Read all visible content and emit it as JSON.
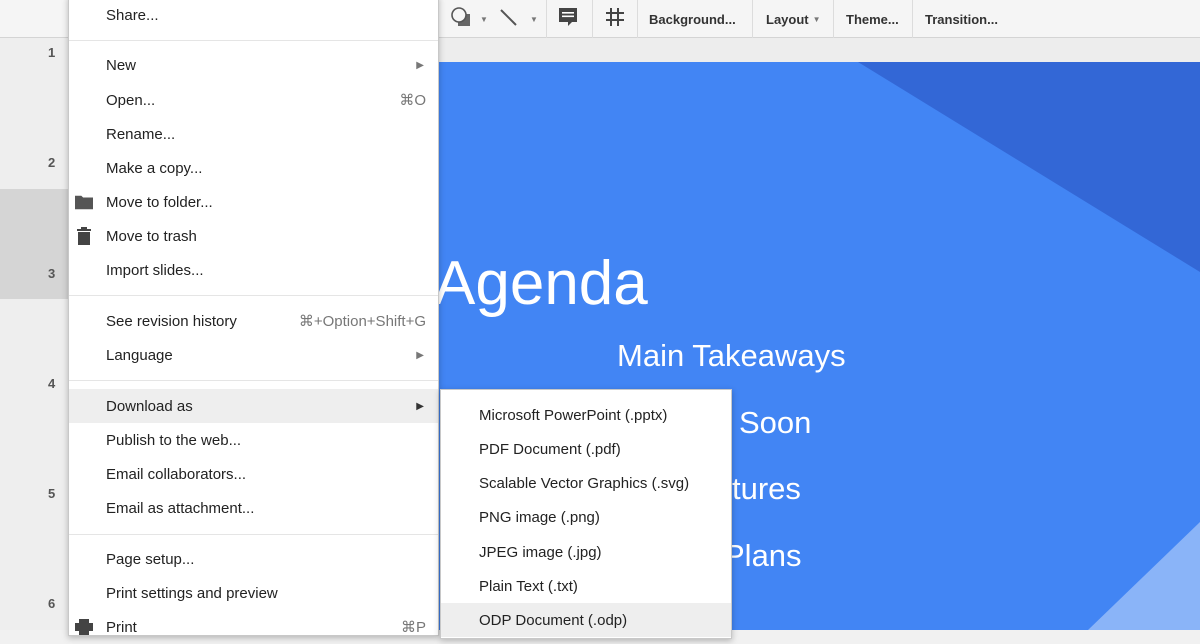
{
  "toolbar": {
    "icons": [
      "shape-icon",
      "line-icon",
      "comment-icon",
      "grid-icon"
    ],
    "buttons": {
      "background": "Background...",
      "layout": "Layout",
      "theme": "Theme...",
      "transition": "Transition..."
    }
  },
  "filmstrip": {
    "slide_numbers": [
      "1",
      "2",
      "3",
      "4",
      "5",
      "6"
    ],
    "selected": "2"
  },
  "slide": {
    "title": "Agenda",
    "lines": [
      "Main Takeaways",
      "Soon",
      "tures",
      "Plans"
    ],
    "colors": {
      "background": "#4285f4",
      "shape_dark": "#3367d6",
      "shape_light": "#8ab4f8"
    }
  },
  "file_menu": {
    "share": "Share...",
    "new": "New",
    "open": "Open...",
    "open_shortcut": "⌘O",
    "rename": "Rename...",
    "make_copy": "Make a copy...",
    "move_to_folder": "Move to folder...",
    "move_to_trash": "Move to trash",
    "import_slides": "Import slides...",
    "revision_history": "See revision history",
    "revision_shortcut": "⌘+Option+Shift+G",
    "language": "Language",
    "download_as": "Download as",
    "publish": "Publish to the web...",
    "email_collaborators": "Email collaborators...",
    "email_attachment": "Email as attachment...",
    "page_setup": "Page setup...",
    "print_settings": "Print settings and preview",
    "print": "Print",
    "print_shortcut": "⌘P"
  },
  "download_submenu": {
    "items": [
      "Microsoft PowerPoint (.pptx)",
      "PDF Document (.pdf)",
      "Scalable Vector Graphics (.svg)",
      "PNG image (.png)",
      "JPEG image (.jpg)",
      "Plain Text (.txt)",
      "ODP Document (.odp)"
    ],
    "highlighted": "ODP Document (.odp)"
  }
}
